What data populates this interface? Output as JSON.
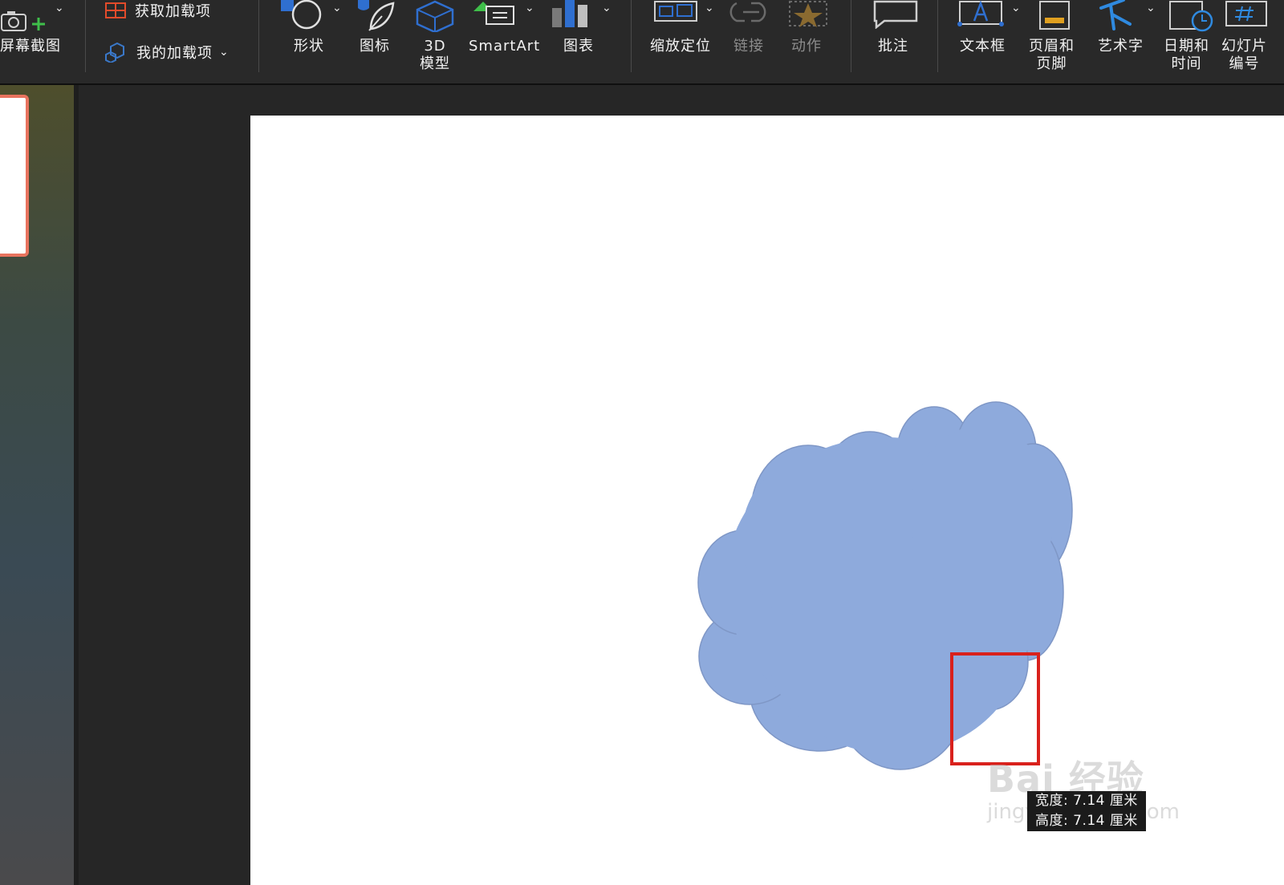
{
  "ribbon": {
    "screenshot": {
      "label": "屏幕截图"
    },
    "addins": {
      "get": "获取加载项",
      "mine": "我的加载项"
    },
    "shapes": {
      "label": "形状"
    },
    "icons": {
      "label": "图标"
    },
    "model3d": {
      "label": "3D\n模型"
    },
    "smartart": {
      "label": "SmartArt"
    },
    "chart": {
      "label": "图表"
    },
    "zoom": {
      "label": "缩放定位"
    },
    "link": {
      "label": "链接"
    },
    "action": {
      "label": "动作"
    },
    "comment": {
      "label": "批注"
    },
    "textbox": {
      "label": "文本框"
    },
    "headerfooter": {
      "label": "页眉和\n页脚"
    },
    "wordart": {
      "label": "艺术字"
    },
    "datetime": {
      "label": "日期和\n时间"
    },
    "slidenumber": {
      "label": "幻灯片\n编号"
    }
  },
  "slide": {
    "shape_fill": "#8eaadc",
    "shape_stroke": "#7f97c6",
    "highlight_color": "#d9211c"
  },
  "tooltip": {
    "width": "宽度: 7.14 厘米",
    "height": "高度: 7.14 厘米"
  },
  "watermark": {
    "brand": "Bai 经验",
    "url": "jingyan.baidu.com"
  }
}
